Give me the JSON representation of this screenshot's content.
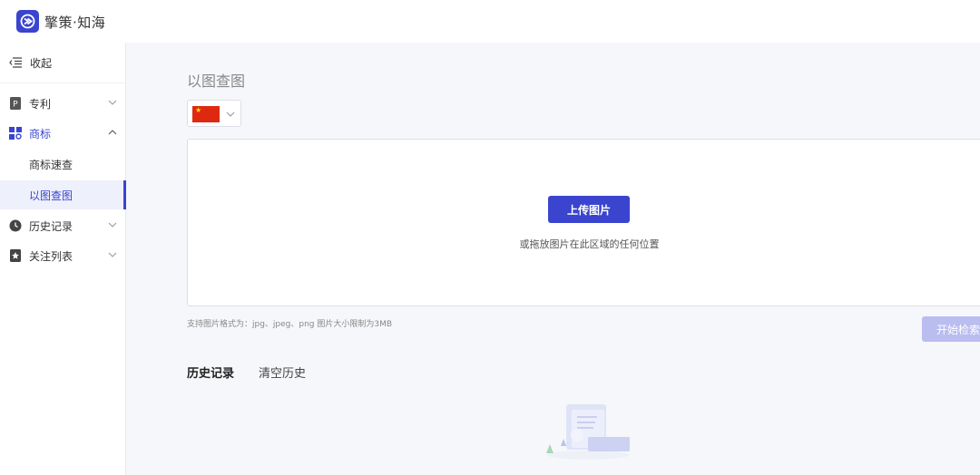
{
  "app": {
    "title": "擎策·知海"
  },
  "sidebar": {
    "collapse_label": "收起",
    "items": [
      {
        "label": "专利"
      },
      {
        "label": "商标"
      },
      {
        "label": "商标速查"
      },
      {
        "label": "以图查图"
      },
      {
        "label": "历史记录"
      },
      {
        "label": "关注列表"
      }
    ]
  },
  "main": {
    "title": "以图查图",
    "upload_button": "上传图片",
    "upload_hint": "或拖放图片在此区域的任何位置",
    "format_hint": "支持图片格式为：jpg、jpeg、png 图片大小限制为3MB",
    "search_button": "开始检索",
    "history_tab": "历史记录",
    "clear_history": "清空历史"
  },
  "colors": {
    "accent": "#3a44cf",
    "disabled": "#b9bdf0"
  }
}
